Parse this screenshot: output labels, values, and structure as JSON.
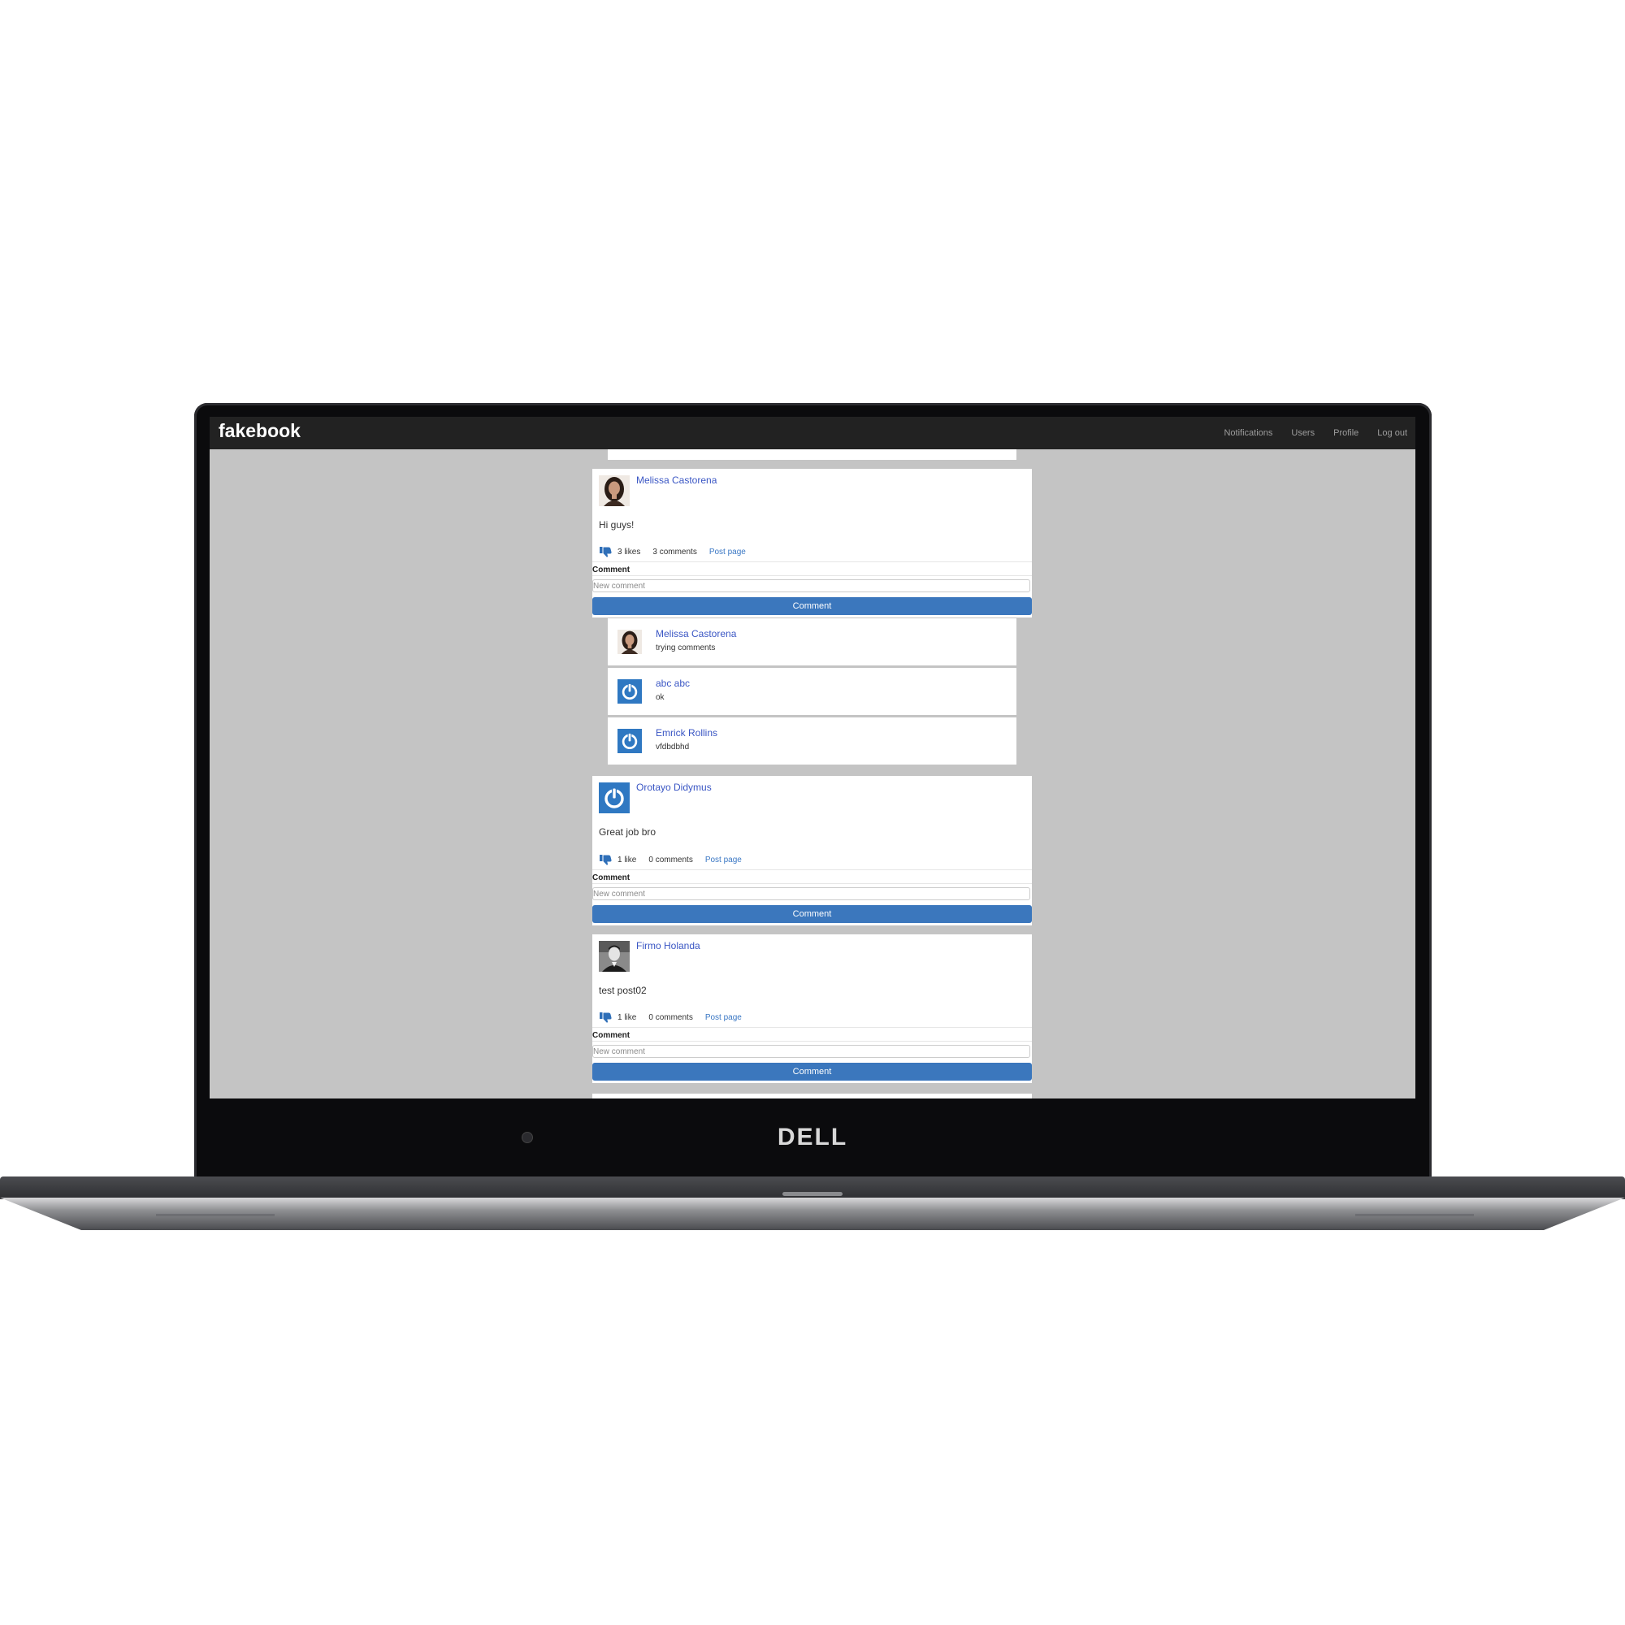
{
  "device": {
    "brand": "DELL"
  },
  "navbar": {
    "logo": "fakebook",
    "links": [
      "Notifications",
      "Users",
      "Profile",
      "Log out"
    ]
  },
  "posts": [
    {
      "author": "Melissa Castorena",
      "avatar": "photo-avatar-woman",
      "text": "Hi guys!",
      "likes": "3 likes",
      "comments_count": "3 comments",
      "post_page_link": "Post page",
      "comment_label": "Comment",
      "comment_placeholder": "New comment",
      "comment_button": "Comment",
      "comments": [
        {
          "author": "Melissa Castorena",
          "avatar": "photo-avatar-woman",
          "text": "trying comments"
        },
        {
          "author": "abc abc",
          "avatar": "power-icon-avatar",
          "text": "ok"
        },
        {
          "author": "Emrick Rollins",
          "avatar": "power-icon-avatar",
          "text": "vfdbdbhd"
        }
      ]
    },
    {
      "author": "Orotayo Didymus",
      "avatar": "power-icon-avatar",
      "text": "Great job bro",
      "likes": "1 like",
      "comments_count": "0 comments",
      "post_page_link": "Post page",
      "comment_label": "Comment",
      "comment_placeholder": "New comment",
      "comment_button": "Comment"
    },
    {
      "author": "Firmo Holanda",
      "avatar": "photo-avatar-man",
      "text": "test post02",
      "likes": "1 like",
      "comments_count": "0 comments",
      "post_page_link": "Post page",
      "comment_label": "Comment",
      "comment_placeholder": "New comment",
      "comment_button": "Comment"
    }
  ],
  "colors": {
    "navbar": "#222222",
    "page_background": "#c4c4c4",
    "link": "#3a56c4",
    "button": "#3b77bd"
  }
}
